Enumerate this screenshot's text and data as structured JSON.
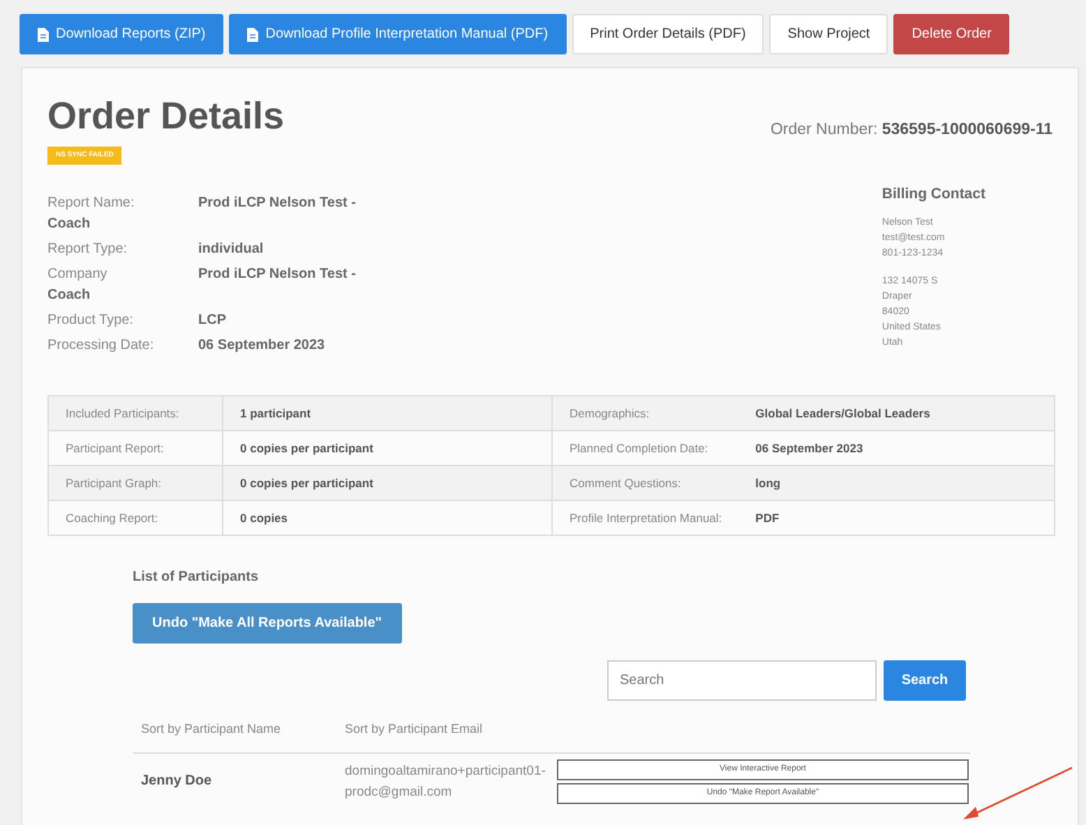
{
  "toolbar": [
    {
      "label": "Download Reports (ZIP)",
      "kind": "primary",
      "icon": true
    },
    {
      "label": "Download Profile Interpretation Manual (PDF)",
      "kind": "primary",
      "icon": true
    },
    {
      "label": "Print Order Details (PDF)",
      "kind": "light",
      "icon": false
    },
    {
      "label": "Show Project",
      "kind": "light",
      "icon": false
    },
    {
      "label": "Delete Order",
      "kind": "danger",
      "icon": false
    }
  ],
  "title": "Order Details",
  "status_badge": "NS SYNC FAILED",
  "order_number": {
    "label": "Order Number:",
    "value": "536595-1000060699-11"
  },
  "details": [
    {
      "label": "Report Name:",
      "value": "Prod iLCP Nelson Test -",
      "continuation": "Coach"
    },
    {
      "label": "Report Type:",
      "value": "individual"
    },
    {
      "label": "Company",
      "value": "Prod iLCP Nelson Test -",
      "continuation": "Coach"
    },
    {
      "label": "Product Type:",
      "value": "LCP"
    },
    {
      "label": "Processing Date:",
      "value": "06 September 2023"
    }
  ],
  "billing_contact": {
    "heading": "Billing Contact",
    "lines": [
      "Nelson Test",
      "test@test.com",
      "801-123-1234"
    ],
    "address": [
      "132 14075 S",
      "Draper",
      "84020",
      "United States",
      "Utah"
    ]
  },
  "summary": [
    {
      "left_label": "Included Participants:",
      "left_value": "1 participant",
      "right_label": "Demographics:",
      "right_value": "Global Leaders/Global Leaders"
    },
    {
      "left_label": "Participant Report:",
      "left_value": "0 copies per participant",
      "right_label": "Planned Completion Date:",
      "right_value": "06 September 2023"
    },
    {
      "left_label": "Participant Graph:",
      "left_value": "0 copies per participant",
      "right_label": "Comment Questions:",
      "right_value": "long"
    },
    {
      "left_label": "Coaching Report:",
      "left_value": "0 copies",
      "right_label": "Profile Interpretation Manual:",
      "right_value": "PDF"
    }
  ],
  "participants": {
    "heading": "List of Participants",
    "undo_all_button": "Undo \"Make All Reports Available\"",
    "search": {
      "placeholder": "Search",
      "button": "Search"
    },
    "columns": [
      "Sort by Participant Name",
      "Sort by Participant Email"
    ],
    "rows": [
      {
        "name": "Jenny Doe",
        "email": "domingoaltamirano+participant01-prodc@gmail.com",
        "actions": [
          "View Interactive Report",
          "Undo \"Make Report Available\""
        ]
      }
    ]
  }
}
